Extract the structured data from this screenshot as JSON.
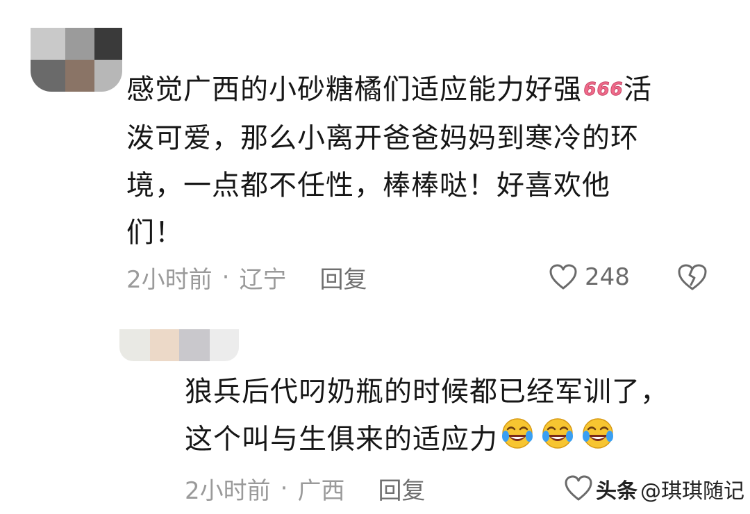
{
  "comments": [
    {
      "lines": [
        "感觉广西的小砂糖橘们适应能力好强",
        "活",
        "泼可爱，那么小离开爸爸妈妈到寒冷的环",
        "境，一点都不任性，棒棒哒！好喜欢他",
        "们！"
      ],
      "emoji": "666-emoji",
      "emoji_text": "666",
      "time": "2小时前",
      "separator": "·",
      "location": "辽宁",
      "reply_label": "回复",
      "like_count": "248",
      "like_icon": "heart-outline-icon",
      "dislike_icon": "broken-heart-icon"
    },
    {
      "lines": [
        "狼兵后代叼奶瓶的时候都已经军训了，",
        "这个叫与生俱来的适应力"
      ],
      "emoji": "laugh-cry-emoji",
      "emoji_count": 3,
      "time": "2小时前",
      "separator": "·",
      "location": "广西",
      "reply_label": "回复",
      "like_icon": "heart-outline-icon"
    }
  ],
  "watermark": {
    "brand": "头条",
    "handle": "@琪琪随记"
  },
  "colors": {
    "text": "#161616",
    "meta": "#9a9a9a",
    "emoji_pink": "#f06a8a",
    "emoji_yellow": "#f7c531",
    "emoji_tear": "#3a9ff2"
  }
}
